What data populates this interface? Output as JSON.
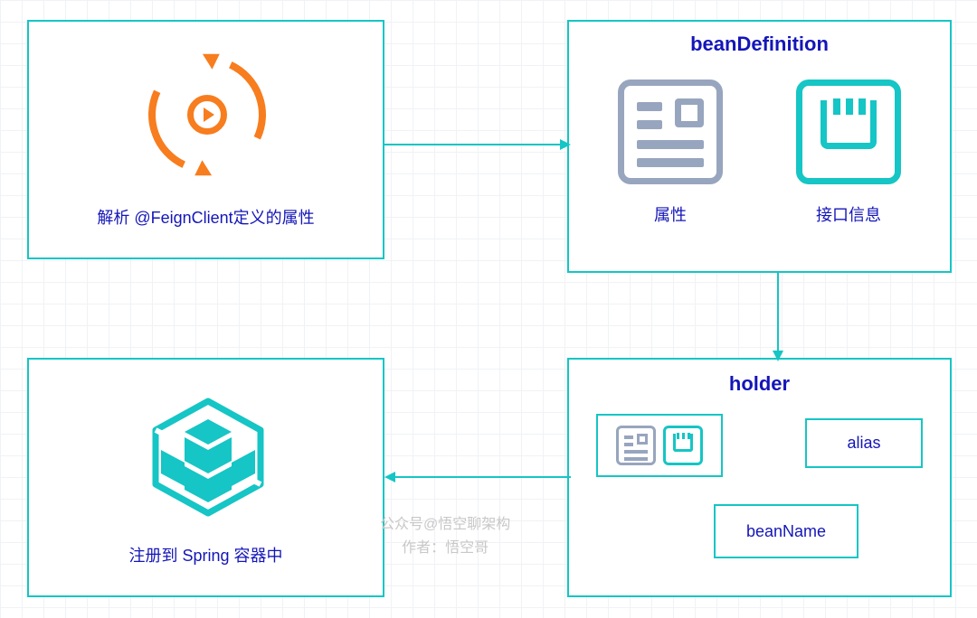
{
  "boxes": {
    "parse": {
      "caption": "解析 @FeignClient定义的属性"
    },
    "beanDef": {
      "title": "beanDefinition",
      "labels": {
        "attrs": "属性",
        "iface": "接口信息"
      }
    },
    "register": {
      "caption": "注册到 Spring 容器中"
    },
    "holder": {
      "title": "holder",
      "items": {
        "alias": "alias",
        "beanName": "beanName"
      }
    }
  },
  "watermark": {
    "line1": "公众号@悟空聊架构",
    "line2": "作者：悟空哥"
  }
}
